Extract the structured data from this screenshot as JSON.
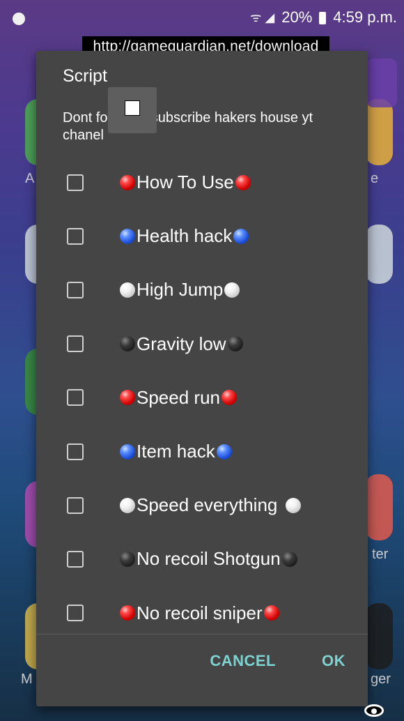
{
  "status_bar": {
    "battery_percent": "20%",
    "time": "4:59 p.m.",
    "signal_text": "ᯤ ◢"
  },
  "url_banner": "http://gameguardian.net/download",
  "dialog": {
    "title": "Script",
    "message": "Dont forget to subscribe hakers house yt chanel",
    "options": [
      {
        "label": "How To Use",
        "ball": "red"
      },
      {
        "label": "Health hack",
        "ball": "blue"
      },
      {
        "label": "High Jump",
        "ball": "white"
      },
      {
        "label": "Gravity low",
        "ball": "black"
      },
      {
        "label": "Speed run",
        "ball": "red"
      },
      {
        "label": "Item hack",
        "ball": "blue"
      },
      {
        "label": "Speed everything",
        "ball": "white"
      },
      {
        "label": "No recoil Shotgun",
        "ball": "black"
      },
      {
        "label": "No recoil sniper",
        "ball": "red"
      }
    ],
    "cancel_label": "CANCEL",
    "ok_label": "OK"
  },
  "background": {
    "labels": [
      "A",
      "e",
      "M",
      "ger",
      "ter"
    ]
  },
  "colors": {
    "dialog_bg": "#454545",
    "accent_button": "#7dd3d0",
    "text": "#ffffff"
  }
}
